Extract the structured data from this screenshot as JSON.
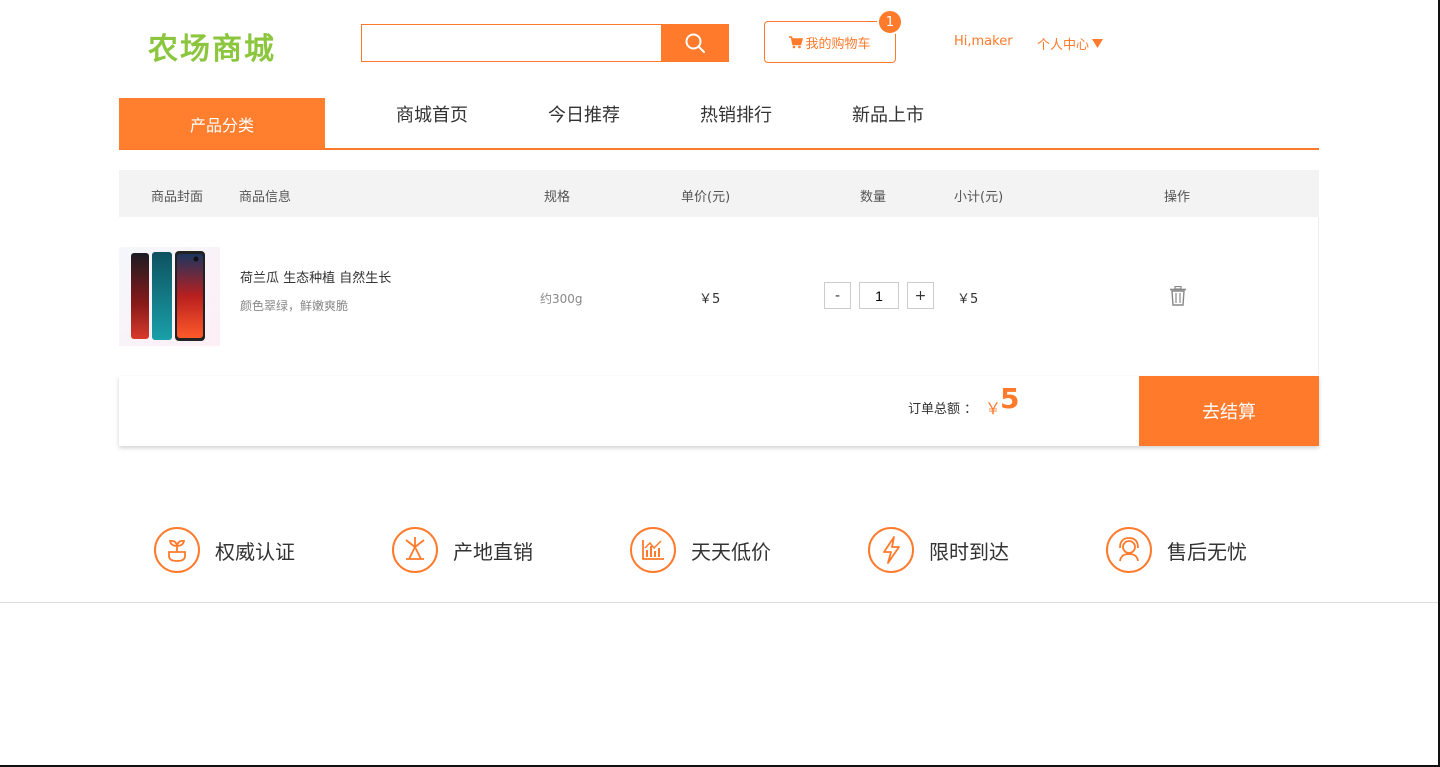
{
  "header": {
    "logo_text": "农场商城",
    "search": {
      "value": "",
      "placeholder": "",
      "icon": "search-icon"
    },
    "cart": {
      "label": "我的购物车",
      "count": "1",
      "icon": "cart-icon"
    },
    "greeting": "Hi,maker",
    "user_center": "个人中心"
  },
  "nav": {
    "category": "产品分类",
    "items": [
      "商城首页",
      "今日推荐",
      "热销排行",
      "新品上市"
    ]
  },
  "table": {
    "headers": [
      "商品封面",
      "商品信息",
      "规格",
      "单价(元)",
      "数量",
      "小计(元)",
      "操作"
    ],
    "rows": [
      {
        "title": "荷兰瓜 生态种植 自然生长",
        "desc": "颜色翠绿，鲜嫩爽脆",
        "spec": "约300g",
        "price": "￥5",
        "quantity": "1",
        "minus": "-",
        "plus": "+",
        "subtotal": "￥5",
        "delete_icon": "trash-icon"
      }
    ]
  },
  "summary": {
    "label": "订单总额 ：",
    "currency": "￥",
    "amount": "5",
    "checkout": "去结算"
  },
  "features": [
    {
      "label": "权威认证",
      "icon": "plant-icon"
    },
    {
      "label": "产地直销",
      "icon": "windmill-icon"
    },
    {
      "label": "天天低价",
      "icon": "chart-icon"
    },
    {
      "label": "限时到达",
      "icon": "lightning-icon"
    },
    {
      "label": "售后无忧",
      "icon": "support-icon"
    }
  ],
  "colors": {
    "accent": "#ff7a2b",
    "logo": "#8cc63f"
  }
}
